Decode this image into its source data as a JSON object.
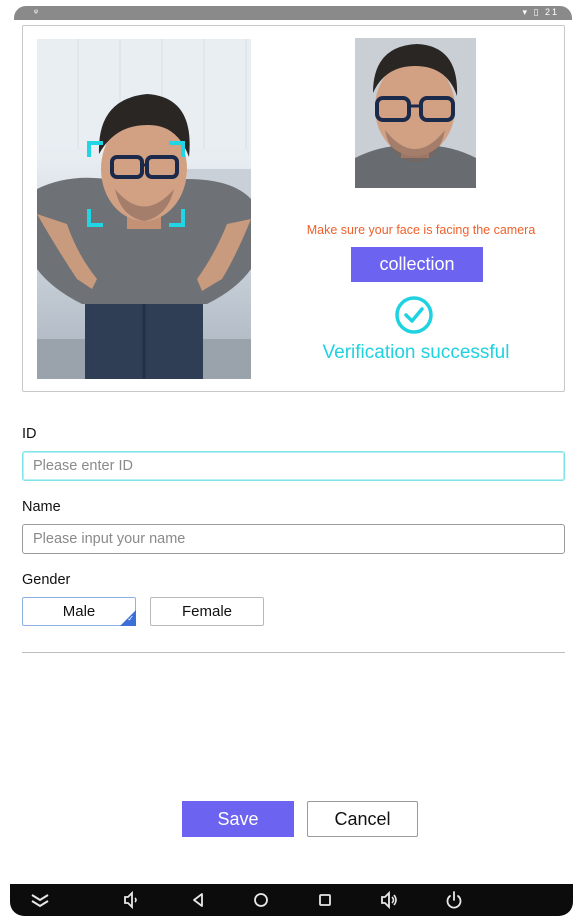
{
  "status_bar": {
    "signal": "ᵠ",
    "right": "▾ ▯ 21"
  },
  "capture": {
    "hint": "Make sure your face is facing the camera",
    "collect_label": "collection",
    "verify_text": "Verification successful",
    "colors": {
      "accent": "#6c63f0",
      "hint": "#f0602a",
      "success": "#1fd2e0",
      "face_frame": "#20d6e4"
    }
  },
  "form": {
    "id": {
      "label": "ID",
      "placeholder": "Please enter ID",
      "value": ""
    },
    "name": {
      "label": "Name",
      "placeholder": "Please input your name",
      "value": ""
    },
    "gender": {
      "label": "Gender",
      "options": [
        "Male",
        "Female"
      ],
      "selected": "Male"
    }
  },
  "actions": {
    "save_label": "Save",
    "cancel_label": "Cancel"
  },
  "nav_icons": [
    "collapse-icon",
    "volume-down-icon",
    "back-icon",
    "home-icon",
    "recents-icon",
    "volume-up-icon",
    "power-icon"
  ]
}
